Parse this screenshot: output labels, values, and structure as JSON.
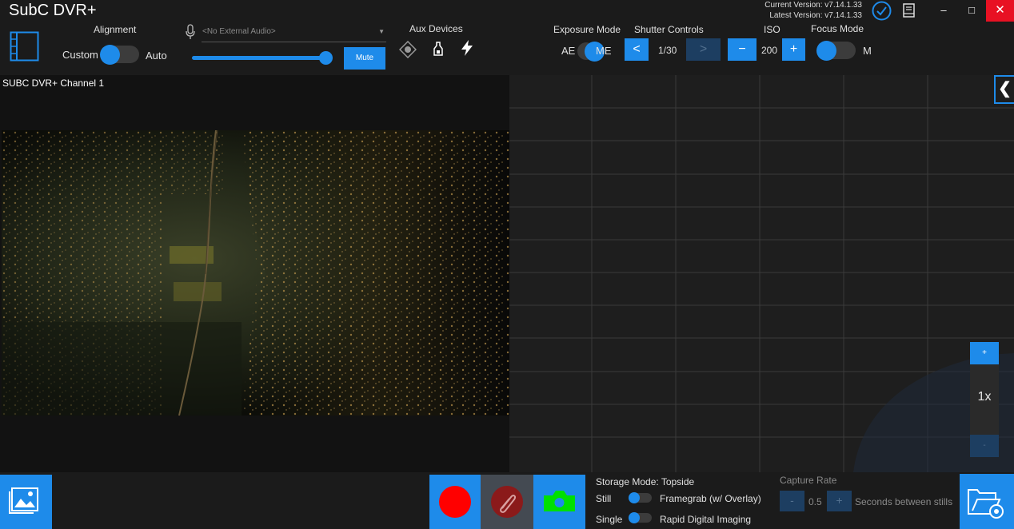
{
  "window": {
    "title": "SubC DVR+",
    "current_version": "Current Version: v7.14.1.33",
    "latest_version": "Latest Version: v7.14.1.33",
    "minimize": "–",
    "maximize": "□",
    "close": "✕"
  },
  "toolbar": {
    "alignment_label": "Alignment",
    "alignment_left": "Custom",
    "alignment_right": "Auto",
    "audio_placeholder": "<No External Audio>",
    "mute_label": "Mute",
    "aux_label": "Aux Devices",
    "aux_icons": [
      "laser-icon",
      "lamp-icon",
      "flash-icon"
    ],
    "exposure_label": "Exposure Mode",
    "exposure_left": "AE",
    "exposure_right": "ME",
    "shutter_label": "Shutter Controls",
    "shutter_prev": "<",
    "shutter_value": "1/30",
    "shutter_next": ">",
    "iso_label": "ISO",
    "iso_minus": "−",
    "iso_value": "200",
    "iso_plus": "+",
    "focus_label": "Focus Mode",
    "focus_right": "M"
  },
  "video": {
    "channel_label": "SUBC DVR+ Channel 1"
  },
  "map": {
    "collapse": "❮",
    "zoom_in": "+",
    "zoom_level": "1x",
    "zoom_out": "-"
  },
  "bottom": {
    "storage_mode": "Storage Mode: Topside",
    "still": "Still",
    "framegrab": "Framegrab (w/ Overlay)",
    "single": "Single",
    "rapid": "Rapid Digital Imaging",
    "capture_rate_label": "Capture Rate",
    "capture_minus": "-",
    "capture_value": "0.5",
    "capture_plus": "+",
    "seconds_label": "Seconds between stills"
  },
  "colors": {
    "accent": "#1e8bea",
    "disabled": "#1d3e61",
    "record": "#ff0000",
    "snapshot": "#00e000",
    "close": "#e81123"
  }
}
